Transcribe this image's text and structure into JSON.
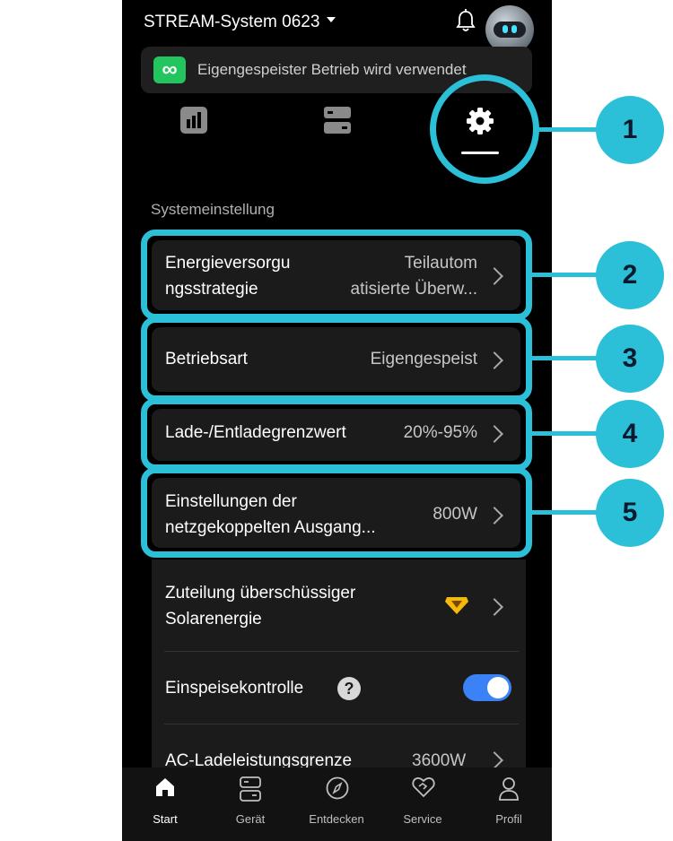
{
  "header": {
    "system_name": "STREAM-System 0623",
    "banner_text": "Eigengespeister Betrieb wird verwendet",
    "banner_icon": "infinity-icon"
  },
  "tabs": [
    {
      "name": "statistics",
      "icon": "bar-chart-icon"
    },
    {
      "name": "devices",
      "icon": "server-icon"
    },
    {
      "name": "settings",
      "icon": "gear-icon",
      "active": true
    }
  ],
  "settings": {
    "section_title": "Systemeinstellung",
    "items": [
      {
        "label_line1": "Energieversorgu",
        "label_line2": "ngsstrategie",
        "value_line1": "Teilautom",
        "value_line2": "atisierte Überw..."
      },
      {
        "label": "Betriebsart",
        "value": "Eigengespeist"
      },
      {
        "label": "Lade-/Entladegrenzwert",
        "value": "20%-95%"
      },
      {
        "label_line1": "Einstellungen der",
        "label_line2": "netzgekoppelten Ausgang...",
        "value": "800W"
      },
      {
        "label_line1": "Zuteilung überschüssiger",
        "label_line2": "Solarenergie"
      },
      {
        "label": "Einspeisekontrolle",
        "help": "?",
        "toggle_on": true
      },
      {
        "label": "AC-Ladeleistungsgrenze",
        "value": "3600W"
      }
    ]
  },
  "nav": {
    "items": [
      {
        "label": "Start",
        "icon": "home-icon"
      },
      {
        "label": "Gerät",
        "icon": "device-icon"
      },
      {
        "label": "Entdecken",
        "icon": "compass-icon"
      },
      {
        "label": "Service",
        "icon": "service-icon"
      },
      {
        "label": "Profil",
        "icon": "profile-icon"
      }
    ]
  },
  "callouts": [
    "1",
    "2",
    "3",
    "4",
    "5"
  ],
  "colors": {
    "accent": "#2bbfd8",
    "toggle": "#3b82f6",
    "badge": "#22c55e",
    "premium": "#f5b90a"
  }
}
